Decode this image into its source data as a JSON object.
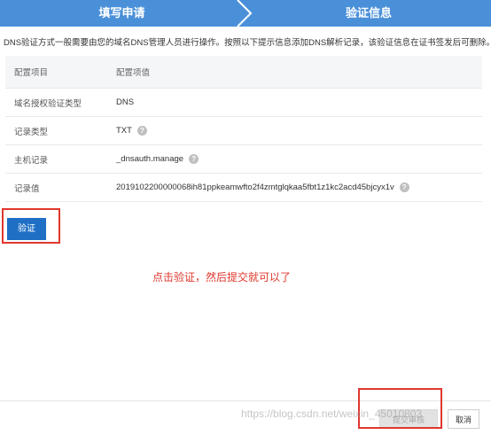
{
  "stepper": {
    "step1_label": "填写申请",
    "step2_label": "验证信息"
  },
  "notice": "DNS验证方式一般需要由您的域名DNS管理人员进行操作。按照以下提示信息添加DNS解析记录，该验证信息在证书签发后可删除。",
  "table": {
    "headers": [
      "配置项目",
      "配置项值"
    ],
    "rows": [
      {
        "label": "域名授权验证类型",
        "value": "DNS",
        "help": false
      },
      {
        "label": "记录类型",
        "value": "TXT",
        "help": true
      },
      {
        "label": "主机记录",
        "value": "_dnsauth.manage",
        "help": true
      },
      {
        "label": "记录值",
        "value": "2019102200000068ih81ppkeamwfto2f4zmtglqkaa5fbt1z1kc2acd45bjcyx1v",
        "help": true
      }
    ]
  },
  "verify_button": "验证",
  "annotation": "点击验证，然后提交就可以了",
  "footer": {
    "submit_label": "提交审核",
    "cancel_label": "取消"
  },
  "watermark": "https://blog.csdn.net/weixin_45010803",
  "colors": {
    "stepper_bg": "#4a90d9",
    "primary_button": "#1f6fc5",
    "annotation_red": "#e0372d"
  },
  "icons": {
    "help": "question-circle-icon"
  }
}
